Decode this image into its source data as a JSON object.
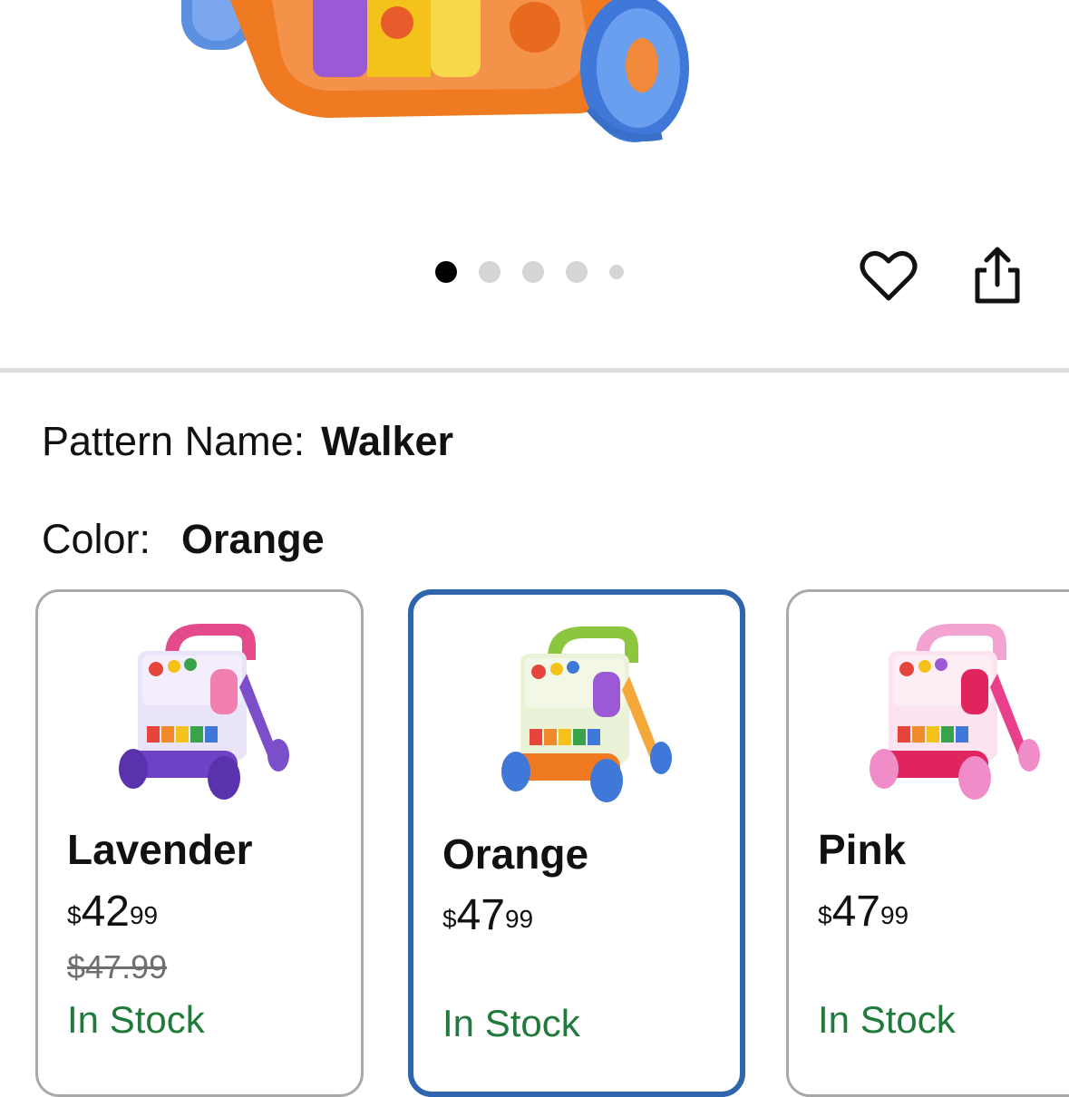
{
  "gallery": {
    "dot_count": 5,
    "active_index": 0
  },
  "actions": {
    "favorite_icon": "heart-outline-icon",
    "share_icon": "share-icon"
  },
  "pattern": {
    "label": "Pattern Name:",
    "value": "Walker"
  },
  "color": {
    "label": "Color:",
    "value": "Orange"
  },
  "swatches": [
    {
      "name": "Lavender",
      "currency": "$",
      "whole": "42",
      "fraction": "99",
      "was": "$47.99",
      "stock": "In Stock",
      "selected": false,
      "accent": "#8a5fd0"
    },
    {
      "name": "Orange",
      "currency": "$",
      "whole": "47",
      "fraction": "99",
      "was": "",
      "stock": "In Stock",
      "selected": true,
      "accent": "#f28c2a"
    },
    {
      "name": "Pink",
      "currency": "$",
      "whole": "47",
      "fraction": "99",
      "was": "",
      "stock": "In Stock",
      "selected": false,
      "accent": "#e8408a"
    }
  ],
  "colors": {
    "selected_border": "#2f65ad",
    "in_stock": "#1f7a3c"
  }
}
